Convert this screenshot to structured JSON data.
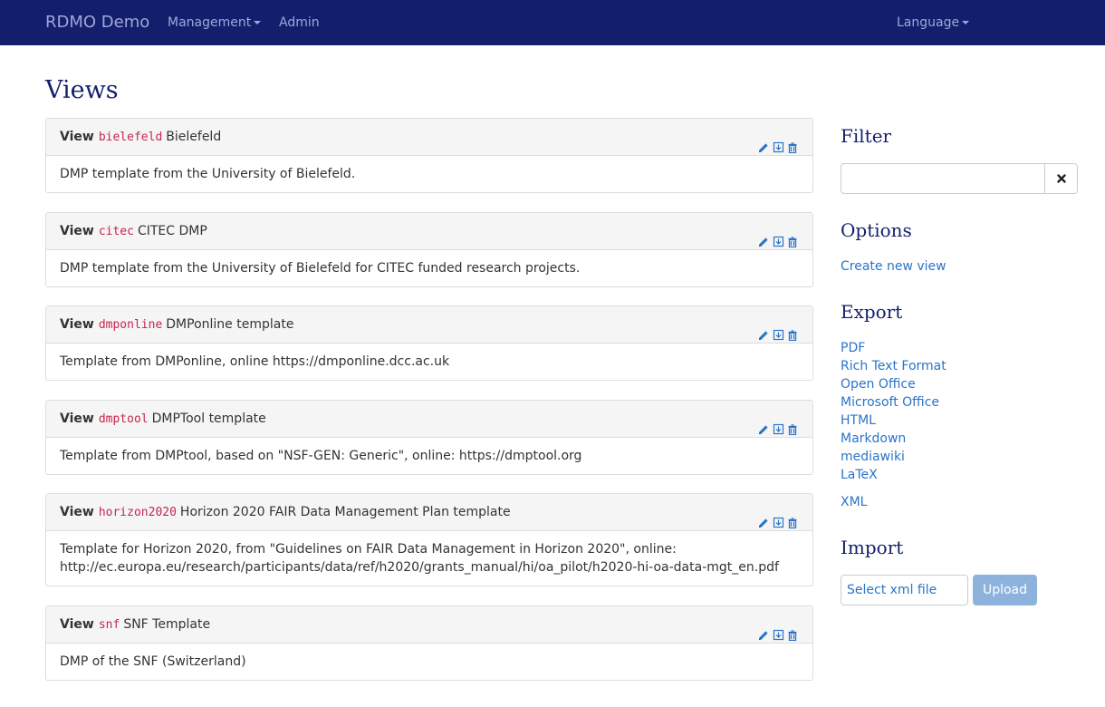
{
  "navbar": {
    "brand": "RDMO Demo",
    "management": "Management",
    "admin": "Admin",
    "language": "Language"
  },
  "page_title": "Views",
  "views": [
    {
      "label": "View",
      "key": "bielefeld",
      "title": "Bielefeld",
      "description": "DMP template from the University of Bielefeld."
    },
    {
      "label": "View",
      "key": "citec",
      "title": "CITEC DMP",
      "description": "DMP template from the University of Bielefeld for CITEC funded research projects."
    },
    {
      "label": "View",
      "key": "dmponline",
      "title": "DMPonline template",
      "description": "Template from DMPonline, online https://dmponline.dcc.ac.uk"
    },
    {
      "label": "View",
      "key": "dmptool",
      "title": "DMPTool template",
      "description": "Template from DMPtool, based on \"NSF-GEN: Generic\", online: https://dmptool.org"
    },
    {
      "label": "View",
      "key": "horizon2020",
      "title": "Horizon 2020 FAIR Data Management Plan template",
      "description": "Template for Horizon 2020, from \"Guidelines on FAIR Data Management in Horizon 2020\", online: http://ec.europa.eu/research/participants/data/ref/h2020/grants_manual/hi/oa_pilot/h2020-hi-oa-data-mgt_en.pdf"
    },
    {
      "label": "View",
      "key": "snf",
      "title": "SNF Template",
      "description": "DMP of the SNF (Switzerland)"
    }
  ],
  "sidebar": {
    "filter": {
      "heading": "Filter",
      "value": "",
      "clear_icon": "times-icon"
    },
    "options": {
      "heading": "Options",
      "create_new": "Create new view"
    },
    "export": {
      "heading": "Export",
      "formats": [
        "PDF",
        "Rich Text Format",
        "Open Office",
        "Microsoft Office",
        "HTML",
        "Markdown",
        "mediawiki",
        "LaTeX"
      ],
      "xml": "XML"
    },
    "import": {
      "heading": "Import",
      "file_label": "Select xml file",
      "upload": "Upload"
    }
  },
  "colors": {
    "navbar": "#131f6c",
    "heading": "#131f6c",
    "link": "#2a74c9",
    "code": "#c7254e",
    "upload_button": "#8db3dc"
  }
}
